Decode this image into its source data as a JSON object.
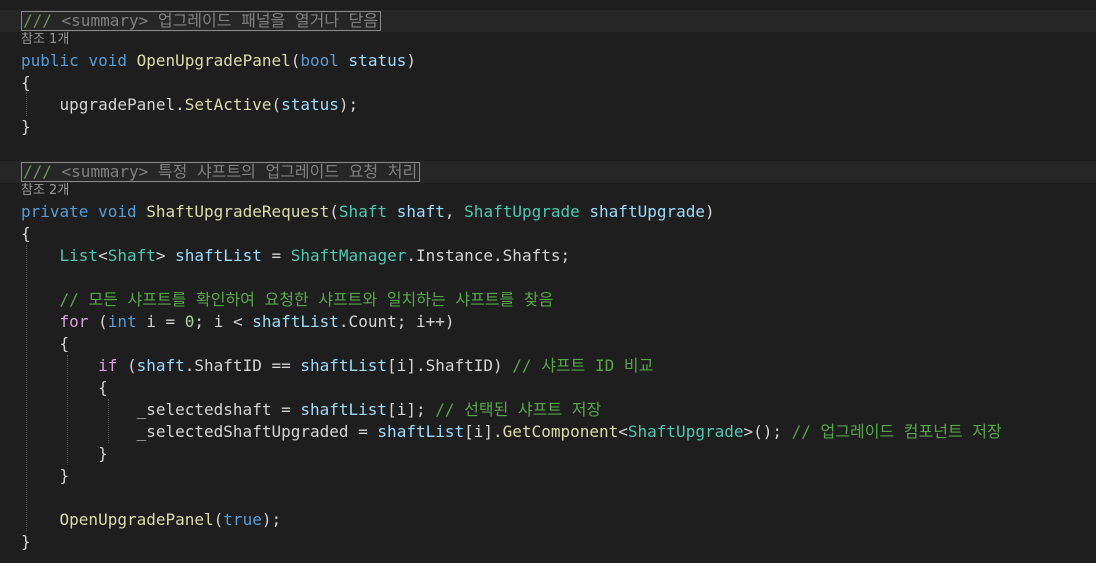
{
  "block1": {
    "summary_slashes": "///",
    "summary_text": " <summary> 업그레이드 패널을 열거나 닫음",
    "references": "참조 1개",
    "sig": {
      "modifier": "public",
      "ret": "void",
      "name": "OpenUpgradePanel",
      "open": "(",
      "ptype": "bool",
      "pname": "status",
      "close": ")"
    },
    "brace_open": "{",
    "body": {
      "obj": "upgradePanel.",
      "method": "SetActive",
      "open": "(",
      "arg": "status",
      "close": ");"
    },
    "brace_close": "}"
  },
  "block2": {
    "summary_slashes": "///",
    "summary_text": " <summary> 특정 샤프트의 업그레이드 요청 처리",
    "references": "참조 2개",
    "sig": {
      "modifier": "private",
      "ret": "void",
      "name": "ShaftUpgradeRequest",
      "open": "(",
      "p1type": "Shaft",
      "p1name": "shaft",
      "comma": ", ",
      "p2type": "ShaftUpgrade",
      "p2name": "shaftUpgrade",
      "close": ")"
    },
    "brace_open": "{",
    "list_line": {
      "t1": "List",
      "lt": "<",
      "t2": "Shaft",
      "gt": "> ",
      "var": "shaftList",
      "eq": " = ",
      "t3": "ShaftManager",
      "rest": ".Instance.Shafts;"
    },
    "comment1": "// 모든 샤프트를 확인하여 요청한 샤프트와 일치하는 샤프트를 찾음",
    "for_line": {
      "kw": "for",
      "p1": " (",
      "int": "int",
      "p2": " i = ",
      "zero": "0",
      "p3": "; i < ",
      "list": "shaftList",
      "p4": ".Count; i++)"
    },
    "brace2_open": "{",
    "if_line": {
      "kw": "if",
      "p1": " (",
      "shaft": "shaft",
      "p2": ".ShaftID == ",
      "list": "shaftList",
      "p3": "[i].ShaftID) ",
      "comment": "// 샤프트 ID 비교"
    },
    "brace3_open": "{",
    "assign1": {
      "lhs": "_selectedshaft = ",
      "list": "shaftList",
      "rest": "[i]; ",
      "comment": "// 선택된 샤프트 저장"
    },
    "assign2": {
      "lhs": "_selectedShaftUpgraded = ",
      "list": "shaftList",
      "p1": "[i].",
      "method": "GetComponent",
      "lt": "<",
      "type": "ShaftUpgrade",
      "p2": ">(); ",
      "comment": "// 업그레이드 컴포넌트 저장"
    },
    "brace3_close": "}",
    "brace2_close": "}",
    "call": {
      "method": "OpenUpgradePanel",
      "open": "(",
      "arg": "true",
      "close": ");"
    },
    "brace_close": "}"
  }
}
